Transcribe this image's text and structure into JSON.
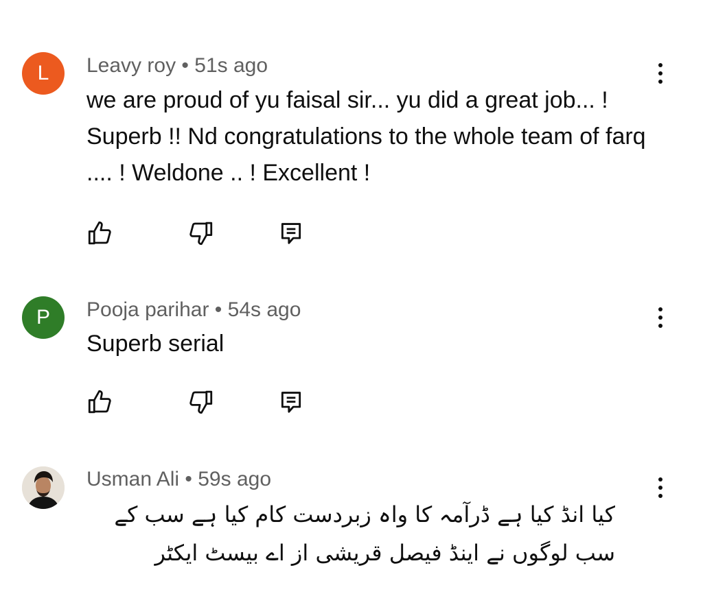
{
  "comments": [
    {
      "avatar_letter": "L",
      "avatar_color": "#ec5a1f",
      "author": "Leavy roy",
      "separator": "•",
      "time": "51s ago",
      "text": "we are proud of yu faisal sir... yu did a great job... ! Superb !! Nd congratulations to the whole team of farq .... ! Weldone .. ! Excellent !",
      "icons": [
        "like-icon",
        "dislike-icon",
        "reply-icon",
        "more-vert-icon"
      ]
    },
    {
      "avatar_letter": "P",
      "avatar_color": "#2f7d28",
      "author": "Pooja parihar",
      "separator": "•",
      "time": "54s ago",
      "text": "Superb serial",
      "icons": [
        "like-icon",
        "dislike-icon",
        "reply-icon",
        "more-vert-icon"
      ]
    },
    {
      "avatar_letter": "",
      "avatar_color": "#3b3b3b",
      "author": "Usman Ali",
      "separator": "•",
      "time": "59s ago",
      "text": "کیا انڈ کیا ہے ڈرآمہ کا واہ زبردست کام کیا ہے سب کے سب لوگوں نے اینڈ فیصل قریشی از اے بیسٹ ایکٹر",
      "icons": [
        "more-vert-icon"
      ]
    }
  ]
}
